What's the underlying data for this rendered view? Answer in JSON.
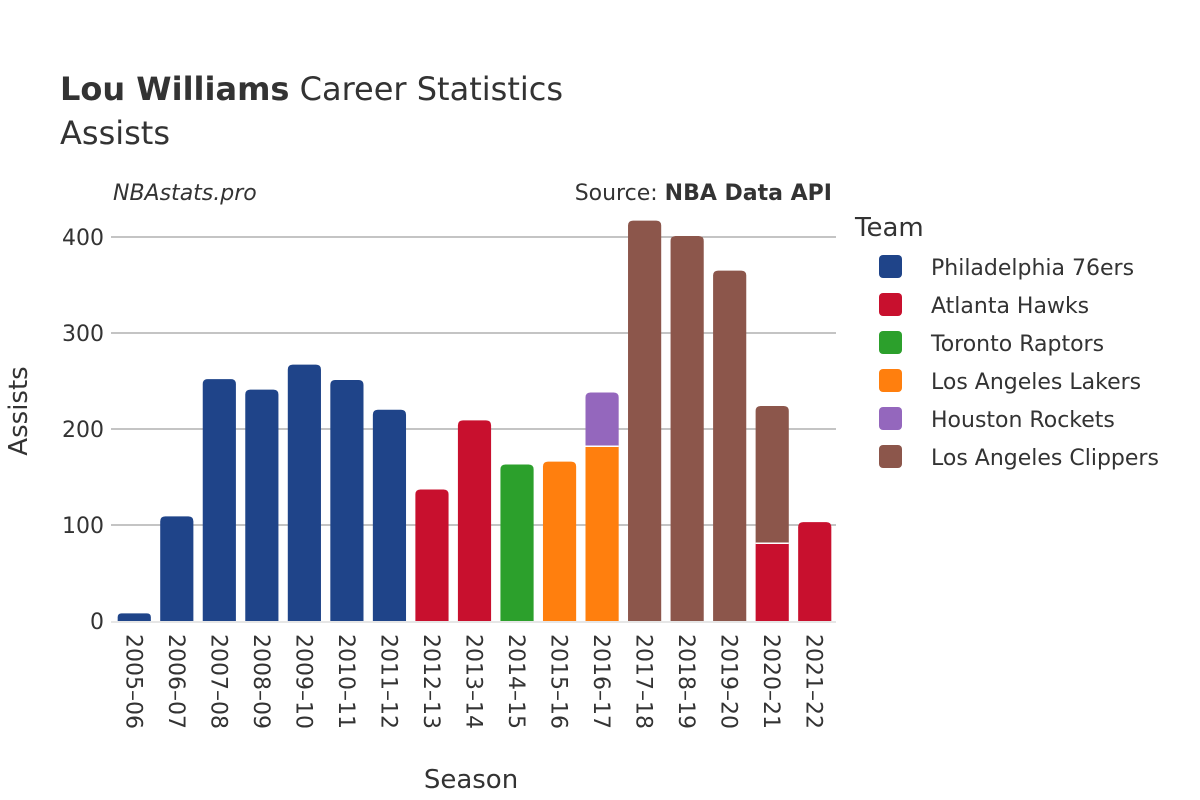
{
  "header": {
    "player_name": "Lou Williams",
    "title_rest": " Career Statistics",
    "subtitle": "Assists",
    "site_credit": "NBAstats.pro",
    "source_prefix": "Source: ",
    "source_name": "NBA Data API"
  },
  "chart_data": {
    "type": "bar",
    "stacked": true,
    "title": "Lou Williams Career Statistics",
    "subtitle": "Assists",
    "xlabel": "Season",
    "ylabel": "Assists",
    "ylim": [
      0,
      420
    ],
    "yticks": [
      0,
      100,
      200,
      300,
      400
    ],
    "grid": true,
    "legend_title": "Team",
    "legend_position": "right",
    "categories": [
      "2005–06",
      "2006–07",
      "2007–08",
      "2008–09",
      "2009–10",
      "2010–11",
      "2011–12",
      "2012–13",
      "2013–14",
      "2014–15",
      "2015–16",
      "2016–17",
      "2017–18",
      "2018–19",
      "2019–20",
      "2020–21",
      "2021–22"
    ],
    "series": [
      {
        "name": "Philadelphia 76ers",
        "color": "#1f4489",
        "values": [
          8,
          109,
          252,
          241,
          267,
          251,
          220,
          0,
          0,
          0,
          0,
          0,
          0,
          0,
          0,
          0,
          0
        ]
      },
      {
        "name": "Atlanta Hawks",
        "color": "#c8102e",
        "values": [
          0,
          0,
          0,
          0,
          0,
          0,
          0,
          137,
          209,
          0,
          0,
          0,
          0,
          0,
          0,
          81,
          103
        ]
      },
      {
        "name": "Toronto Raptors",
        "color": "#2ca02c",
        "values": [
          0,
          0,
          0,
          0,
          0,
          0,
          0,
          0,
          0,
          163,
          0,
          0,
          0,
          0,
          0,
          0,
          0
        ]
      },
      {
        "name": "Los Angeles Lakers",
        "color": "#ff7f0e",
        "values": [
          0,
          0,
          0,
          0,
          0,
          0,
          0,
          0,
          0,
          0,
          166,
          182,
          0,
          0,
          0,
          0,
          0
        ]
      },
      {
        "name": "Houston Rockets",
        "color": "#9467bd",
        "values": [
          0,
          0,
          0,
          0,
          0,
          0,
          0,
          0,
          0,
          0,
          0,
          56,
          0,
          0,
          0,
          0,
          0
        ]
      },
      {
        "name": "Los Angeles Clippers",
        "color": "#8c564b",
        "values": [
          0,
          0,
          0,
          0,
          0,
          0,
          0,
          0,
          0,
          0,
          0,
          0,
          417,
          401,
          365,
          143,
          0
        ]
      }
    ]
  }
}
